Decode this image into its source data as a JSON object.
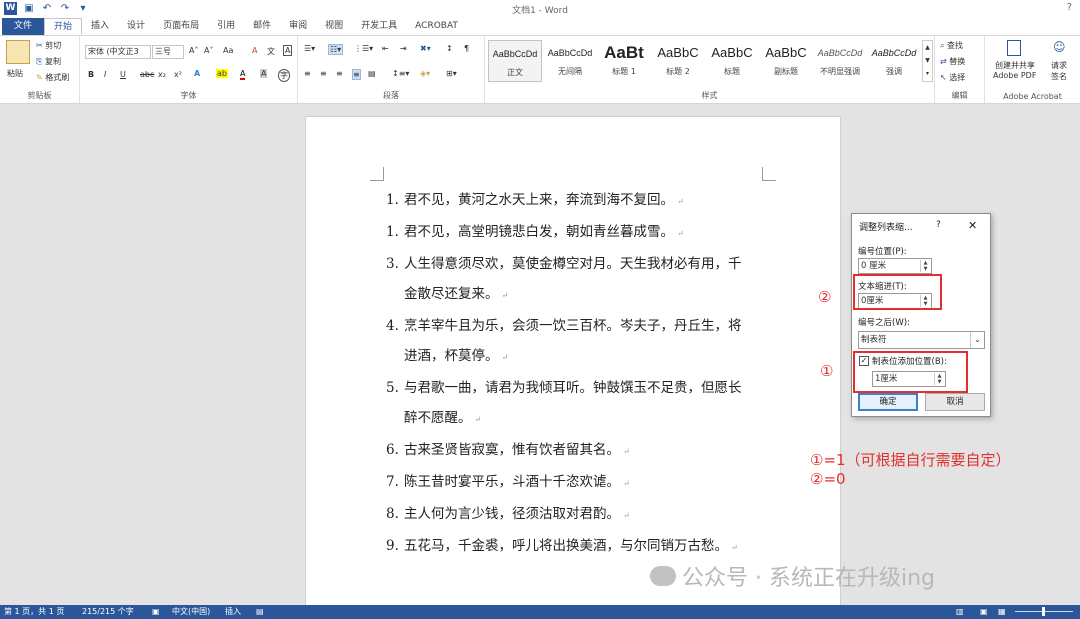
{
  "titlebar": {
    "app_title": "文档1 - Word",
    "help": "?",
    "undo_icon": "undo-icon",
    "redo_icon": "redo-icon",
    "save_icon": "save-icon"
  },
  "tabs": [
    {
      "label": "文件"
    },
    {
      "label": "开始"
    },
    {
      "label": "插入"
    },
    {
      "label": "设计"
    },
    {
      "label": "页面布局"
    },
    {
      "label": "引用"
    },
    {
      "label": "邮件"
    },
    {
      "label": "审阅"
    },
    {
      "label": "视图"
    },
    {
      "label": "开发工具"
    },
    {
      "label": "ACROBAT"
    }
  ],
  "ribbon": {
    "clipboard": {
      "paste": "粘贴",
      "cut": "剪切",
      "copy": "复制",
      "format_painter": "格式刷",
      "group_label": "剪贴板"
    },
    "font": {
      "font_name": "宋体 (中文正3",
      "font_size": "三号",
      "group_label": "字体",
      "grow": "A˄",
      "shrink": "A˅",
      "case": "Aa",
      "clear": "A",
      "pinyin": "文",
      "border": "A",
      "bold": "B",
      "italic": "I",
      "underline": "U",
      "strike": "abc",
      "sub": "x₂",
      "sup": "x²",
      "effects": "A",
      "highlight": "ab",
      "color": "A",
      "shade": "A",
      "circle": "字"
    },
    "paragraph": {
      "group_label": "段落"
    },
    "styles": {
      "group_label": "样式",
      "items": [
        {
          "sample": "AaBbCcDd",
          "name": "正文"
        },
        {
          "sample": "AaBbCcDd",
          "name": "无间隔"
        },
        {
          "sample": "AaBt",
          "name": "标题 1"
        },
        {
          "sample": "AaBbC",
          "name": "标题 2"
        },
        {
          "sample": "AaBbC",
          "name": "标题"
        },
        {
          "sample": "AaBbC",
          "name": "副标题"
        },
        {
          "sample": "AaBbCcDd",
          "name": "不明显强调"
        },
        {
          "sample": "AaBbCcDd",
          "name": "强调"
        }
      ]
    },
    "editing": {
      "find": "查找",
      "replace": "替换",
      "select": "选择",
      "group_label": "编辑"
    },
    "acrobat": {
      "create_share": "创建并共享",
      "adobe_pdf": "Adobe PDF",
      "request": "请求",
      "sign": "签名",
      "group_label": "Adobe Acrobat"
    }
  },
  "document": {
    "lines": [
      {
        "num": "1.",
        "text": "君不见，黄河之水天上来，奔流到海不复回。"
      },
      {
        "num": "1.",
        "text": "君不见，高堂明镜悲白发，朝如青丝暮成雪。"
      },
      {
        "num": "3.",
        "text": "人生得意须尽欢，莫使金樽空对月。天生我材必有用，千"
      },
      {
        "num": "",
        "text": "金散尽还复来。"
      },
      {
        "num": "4.",
        "text": "烹羊宰牛且为乐，会须一饮三百杯。岑夫子，丹丘生，将"
      },
      {
        "num": "",
        "text": "进酒，杯莫停。"
      },
      {
        "num": "5.",
        "text": "与君歌一曲，请君为我倾耳听。钟鼓馔玉不足贵，但愿长"
      },
      {
        "num": "",
        "text": "醉不愿醒。"
      },
      {
        "num": "6.",
        "text": "古来圣贤皆寂寞，惟有饮者留其名。"
      },
      {
        "num": "7.",
        "text": "陈王昔时宴平乐，斗酒十千恣欢谑。"
      },
      {
        "num": "8.",
        "text": "主人何为言少钱，径须沽取对君酌。"
      },
      {
        "num": "9.",
        "text": "五花马，千金裘，呼儿将出换美酒，与尔同销万古愁。"
      }
    ],
    "para_mark": "↵"
  },
  "dialog": {
    "title": "调整列表缩...",
    "help": "?",
    "close": "✕",
    "number_position_label": "编号位置(P):",
    "number_position_value": "0 厘米",
    "text_indent_label": "文本缩进(T):",
    "text_indent_value": "0厘米",
    "follow_label": "编号之后(W):",
    "follow_value": "制表符",
    "tab_stop_label": "制表位添加位置(B):",
    "tab_stop_checked": "✓",
    "tab_stop_value": "1厘米",
    "ok": "确定",
    "cancel": "取消"
  },
  "annotations": {
    "marker1": "①",
    "marker2": "②",
    "note1": "①=1（可根据自行需要自定）",
    "note2": "②=0",
    "color": "#e52f2f"
  },
  "watermark": {
    "text": "公众号 · 系统正在升级ing"
  },
  "statusbar": {
    "page": "第 1 页，共 1 页",
    "words": "215/215 个字",
    "language": "中文(中国)",
    "mode": "插入"
  },
  "colors": {
    "word_blue": "#2b579a"
  }
}
